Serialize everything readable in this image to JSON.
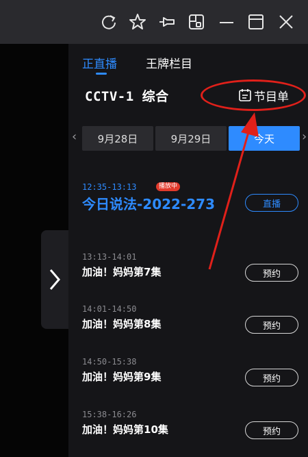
{
  "titlebar": {
    "icons": [
      "refresh-icon",
      "star-icon",
      "pin-icon",
      "picture-in-picture-icon",
      "minimize-icon",
      "maximize-icon",
      "close-icon"
    ]
  },
  "tabs": {
    "live": "正直播",
    "brand": "王牌栏目"
  },
  "channel": "CCTV-1 综合",
  "schedule_label": "节目单",
  "dates": {
    "prev_arrow": "‹",
    "d1": "9月28日",
    "d2": "9月29日",
    "today": "今天",
    "next_arrow": "›"
  },
  "programs": [
    {
      "time": "12:35-13:13",
      "title": "今日说法-2022-273",
      "badge": "播放中",
      "action": "直播"
    },
    {
      "time": "13:13-14:01",
      "title": "加油！妈妈第7集",
      "action": "预约"
    },
    {
      "time": "14:01-14:50",
      "title": "加油！妈妈第8集",
      "action": "预约"
    },
    {
      "time": "14:50-15:38",
      "title": "加油！妈妈第9集",
      "action": "预约"
    },
    {
      "time": "15:38-16:26",
      "title": "加油！妈妈第10集",
      "action": "预约"
    }
  ],
  "colors": {
    "accent": "#2e8bff",
    "annotation": "#e0201a",
    "badge": "#e23a2c"
  }
}
